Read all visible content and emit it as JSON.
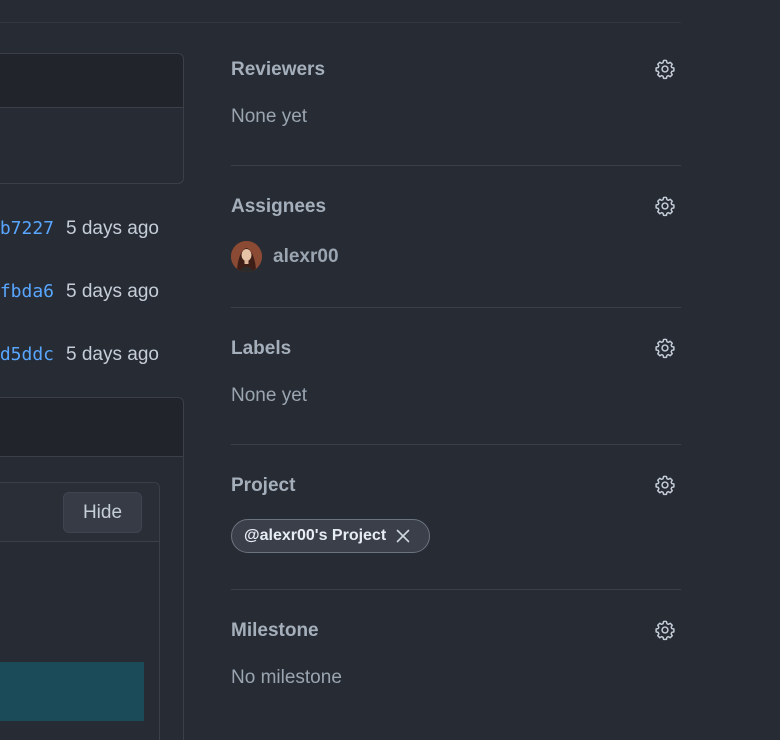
{
  "commits": [
    {
      "sha": "b7227",
      "age": "5 days ago"
    },
    {
      "sha": "fbda6",
      "age": "5 days ago"
    },
    {
      "sha": "d5ddc",
      "age": "5 days ago"
    }
  ],
  "panel": {
    "hide_label": "Hide"
  },
  "sidebar": {
    "reviewers": {
      "title": "Reviewers",
      "value": "None yet",
      "icon": "gear-icon"
    },
    "assignees": {
      "title": "Assignees",
      "icon": "gear-icon",
      "users": [
        {
          "login": "alexr00",
          "avatar": "avatar"
        }
      ]
    },
    "labels": {
      "title": "Labels",
      "value": "None yet",
      "icon": "gear-icon"
    },
    "project": {
      "title": "Project",
      "icon": "gear-icon",
      "chip_label": "@alexr00's Project",
      "chip_close_icon": "close-icon"
    },
    "milestone": {
      "title": "Milestone",
      "value": "No milestone",
      "icon": "gear-icon"
    }
  },
  "colors": {
    "background": "#272b33",
    "link": "#58a6ff",
    "muted_text": "#9aa5b1",
    "divider": "#3a3f49",
    "teal_block": "#1b4b59"
  }
}
